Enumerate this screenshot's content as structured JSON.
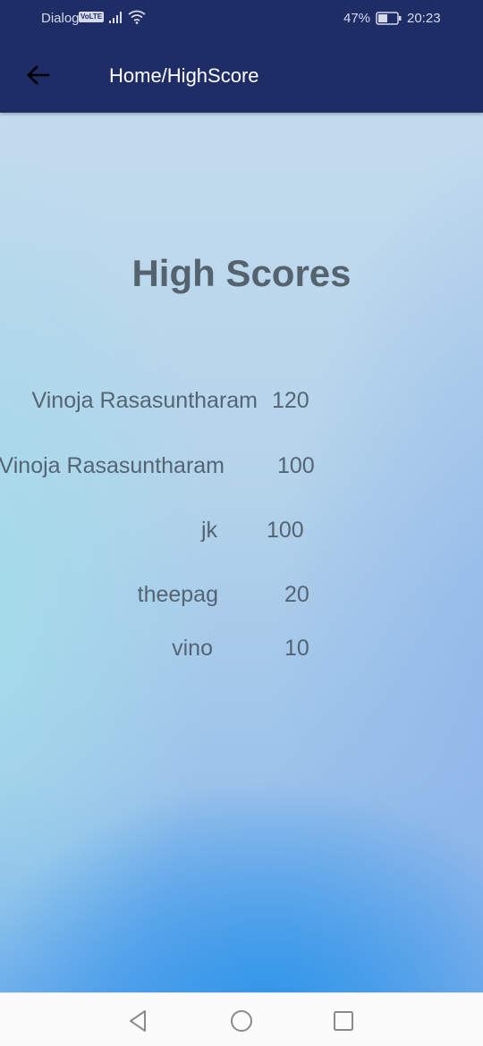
{
  "status_bar": {
    "carrier": "Dialog",
    "volte_badge": "VoLTE",
    "battery_percent": "47%",
    "time": "20:23"
  },
  "app_bar": {
    "title": "Home/HighScore",
    "back_icon": "arrow-left-icon"
  },
  "main": {
    "heading": "High Scores",
    "scores": [
      {
        "name": "Vinoja Rasasuntharam",
        "score": "120"
      },
      {
        "name": "Vinoja Rasasuntharam",
        "score": "100"
      },
      {
        "name": "jk",
        "score": "100"
      },
      {
        "name": "theepag",
        "score": "20"
      },
      {
        "name": "vino",
        "score": "10"
      }
    ]
  },
  "nav_bar": {
    "icons": [
      "back-triangle-icon",
      "home-circle-icon",
      "recents-square-icon"
    ]
  }
}
